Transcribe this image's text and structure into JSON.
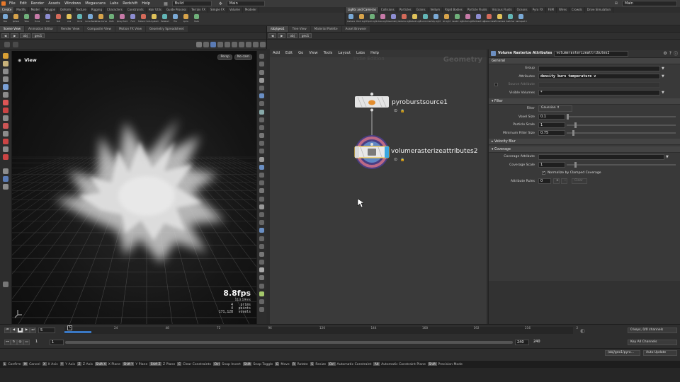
{
  "menubar": {
    "items": [
      "File",
      "Edit",
      "Render",
      "Assets",
      "Windows",
      "Megascans",
      "Labs",
      "Redshift",
      "Help"
    ],
    "build_label": "Build",
    "main_left": "Main",
    "main_right": "Main"
  },
  "shelf_left": {
    "tabs": [
      "Create",
      "Modify",
      "Model",
      "Polygon",
      "Deform",
      "Texture",
      "Rigging",
      "Characters",
      "Constraints",
      "Hair Utils",
      "Guide Process",
      "Terrain FX",
      "Simple FX",
      "Volume",
      "Modeler"
    ],
    "active_tab": 0,
    "tools": [
      "Box",
      "Sphere",
      "Tube",
      "Torus",
      "Grid",
      "Null",
      "Line",
      "Circle",
      "Curve Bezier",
      "Draw Curve",
      "Path",
      "Spray Paint",
      "Font",
      "Platonic Solids",
      "L-System",
      "Metaball",
      "File",
      "Spiral",
      "Helix"
    ]
  },
  "shelf_right": {
    "tabs": [
      "Lights and Cameras",
      "Collisions",
      "Particles",
      "Grains",
      "Vellum",
      "Rigid Bodies",
      "Particle Fluids",
      "Viscous Fluids",
      "Oceans",
      "Pyro FX",
      "FEM",
      "Wires",
      "Crowds",
      "Drive Simulation"
    ],
    "active_tab": 0,
    "tools": [
      "Camera",
      "Point Light",
      "Spot Light",
      "Area Light",
      "Geometry Light",
      "Volume Light",
      "Distant Light",
      "Environment Light",
      "Sky Light",
      "GI Light",
      "Caustic Light",
      "Portal Light",
      "Ambient Light",
      "Stereo Camera",
      "VR Camera",
      "Switcher",
      "Gamepad Camera"
    ]
  },
  "left_panetabs": [
    "Scene View",
    "Animation Editor",
    "Render View",
    "Composite View",
    "Motion FX View",
    "Geometry Spreadsheet"
  ],
  "right_panetabs": [
    "/obj/geo1",
    "Tree View",
    "Material Palette",
    "Asset Browser"
  ],
  "left_path": "obj",
  "left_path2": "geo1",
  "right_path": "obj",
  "right_path2": "geo1",
  "viewport": {
    "title": "View",
    "persp": "Persp",
    "cam": "No cam",
    "fps": "8.8fps",
    "ms": "113.19ms",
    "stats": [
      {
        "n": "4",
        "label": "prims"
      },
      {
        "n": "4",
        "label": "points"
      },
      {
        "n": "171,128",
        "label": "voxels"
      }
    ]
  },
  "network": {
    "menu": [
      "Add",
      "Edit",
      "Go",
      "View",
      "Tools",
      "Layout",
      "Labs",
      "Help"
    ],
    "watermark": "Indie Edition",
    "context": "Geometry",
    "nodes": [
      {
        "name": "pyroburstsource1"
      },
      {
        "name": "volumerasterizeattributes2"
      }
    ]
  },
  "params": {
    "node_type": "Volume Rasterize Attributes",
    "node_name": "volumerasterizeattributes2",
    "sections": {
      "general": "General",
      "filter": "Filter",
      "velocity_blur": "Velocity Blur",
      "coverage": "Coverage"
    },
    "group_label": "Group",
    "attributes_label": "Attributes",
    "attributes_value": "density burn temperature v",
    "source_attr_label": "Source Attribute",
    "visible_volumes_label": "Visible Volumes",
    "visible_volumes_value": "*",
    "filter_label": "Filter",
    "filter_value": "Gaussian",
    "voxel_size_label": "Voxel Size",
    "voxel_size_value": "0.1",
    "particle_scale_label": "Particle Scale",
    "particle_scale_value": "1",
    "min_filter_label": "Minimum Filter Size",
    "min_filter_value": "0.75",
    "coverage_attr_label": "Coverage Attribute",
    "coverage_scale_label": "Coverage Scale",
    "coverage_scale_value": "1",
    "normalize_label": "Normalize by Clamped Coverage",
    "attr_rules_label": "Attribute Rules",
    "attr_rules_value": "0",
    "clear_label": "Clear"
  },
  "timeline": {
    "current_frame": "5",
    "frame_field": "5",
    "ticks": [
      "24",
      "48",
      "72",
      "96",
      "120",
      "144",
      "168",
      "192",
      "216",
      "2"
    ],
    "start_a": "1",
    "start_b": "1",
    "end_a": "240",
    "end_b": "240",
    "keys_label": "0 keys, 0/0 channels",
    "key_all": "Key All Channels",
    "auto_update": "Auto Update",
    "path_display": "/obj/geo1/pyro..."
  },
  "statusbar": {
    "hints": [
      {
        "key": "L",
        "text": "Confirm"
      },
      {
        "key": "M",
        "text": "Cancel"
      },
      {
        "key": "X",
        "text": "X Axis"
      },
      {
        "key": "Y",
        "text": "Y Axis"
      },
      {
        "key": "Z",
        "text": "Z Axis"
      },
      {
        "key": "Shift X",
        "text": "X Plane"
      },
      {
        "key": "Shift Y",
        "text": "Y Plane"
      },
      {
        "key": "Shift Z",
        "text": "Z Plane"
      },
      {
        "key": "C",
        "text": "Clear Constraints"
      },
      {
        "key": "Ctrl",
        "text": "Snap Invert"
      },
      {
        "key": "Shift",
        "text": "Snap Toggle"
      },
      {
        "key": "G",
        "text": "Move"
      },
      {
        "key": "R",
        "text": "Rotate"
      },
      {
        "key": "S",
        "text": "Resize"
      },
      {
        "key": "Ctrl",
        "text": "Automatic Constraint"
      },
      {
        "key": "Alt",
        "text": "Automatic Constraint Plane"
      },
      {
        "key": "Shift",
        "text": "Precision Mode"
      }
    ]
  }
}
